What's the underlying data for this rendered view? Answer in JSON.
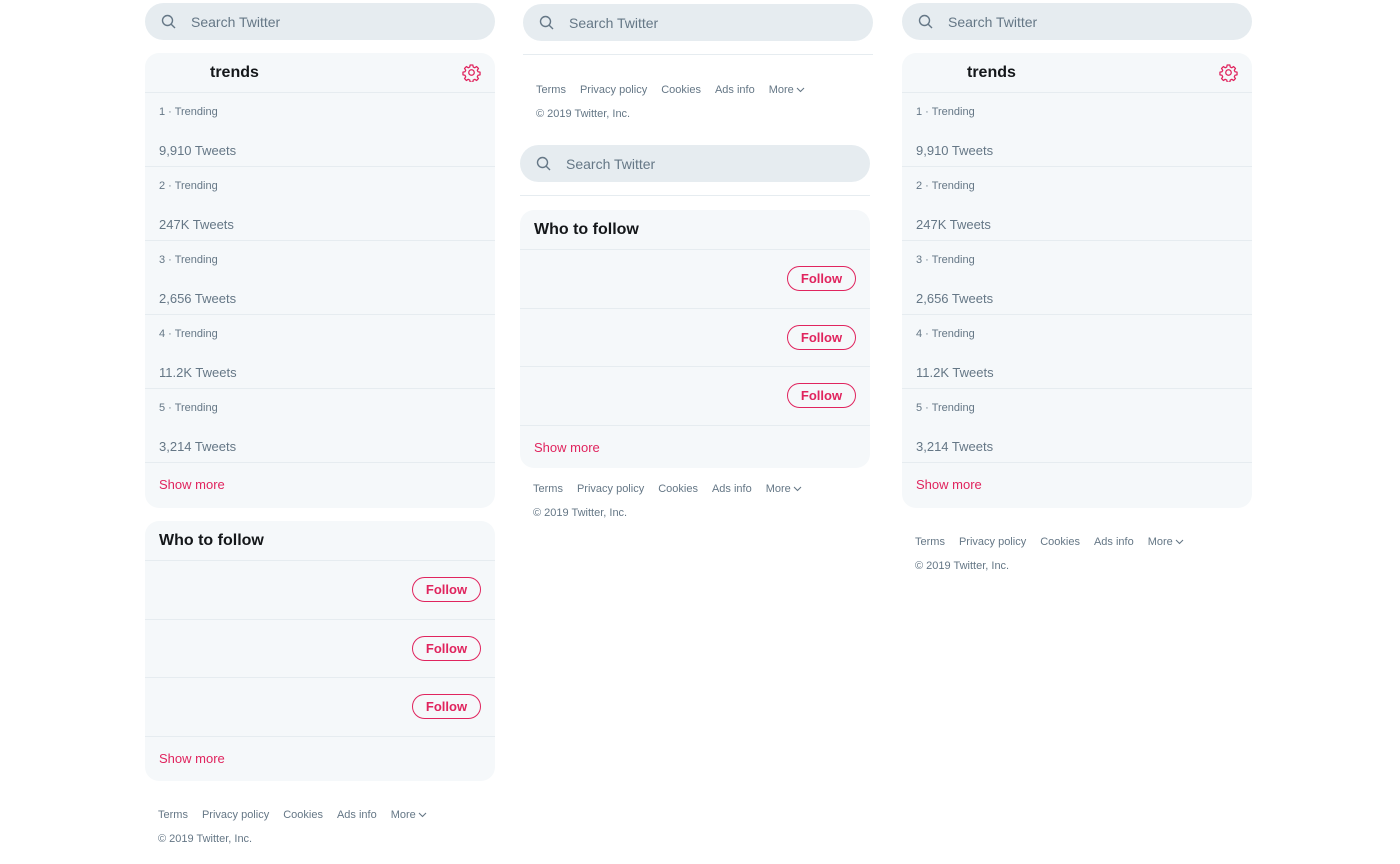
{
  "search": {
    "placeholder": "Search Twitter"
  },
  "trends": {
    "title": "trends",
    "items": [
      {
        "meta": "1 · Trending",
        "count": "9,910 Tweets"
      },
      {
        "meta": "2 · Trending",
        "count": "247K Tweets"
      },
      {
        "meta": "3 · Trending",
        "count": "2,656 Tweets"
      },
      {
        "meta": "4 · Trending",
        "count": "11.2K Tweets"
      },
      {
        "meta": "5 · Trending",
        "count": "3,214 Tweets"
      }
    ],
    "show_more": "Show more"
  },
  "who_to_follow": {
    "title": "Who to follow",
    "follow_label": "Follow",
    "show_more": "Show more"
  },
  "footer": {
    "links": [
      "Terms",
      "Privacy policy",
      "Cookies",
      "Ads info",
      "More"
    ],
    "copyright": "© 2019 Twitter, Inc."
  },
  "colors": {
    "accent": "#e0245e",
    "card_bg": "#f5f8fa",
    "search_bg": "#e6ecf0",
    "muted_text": "#657786"
  },
  "icons": [
    "search-icon",
    "gear-icon",
    "chevron-down-icon"
  ]
}
